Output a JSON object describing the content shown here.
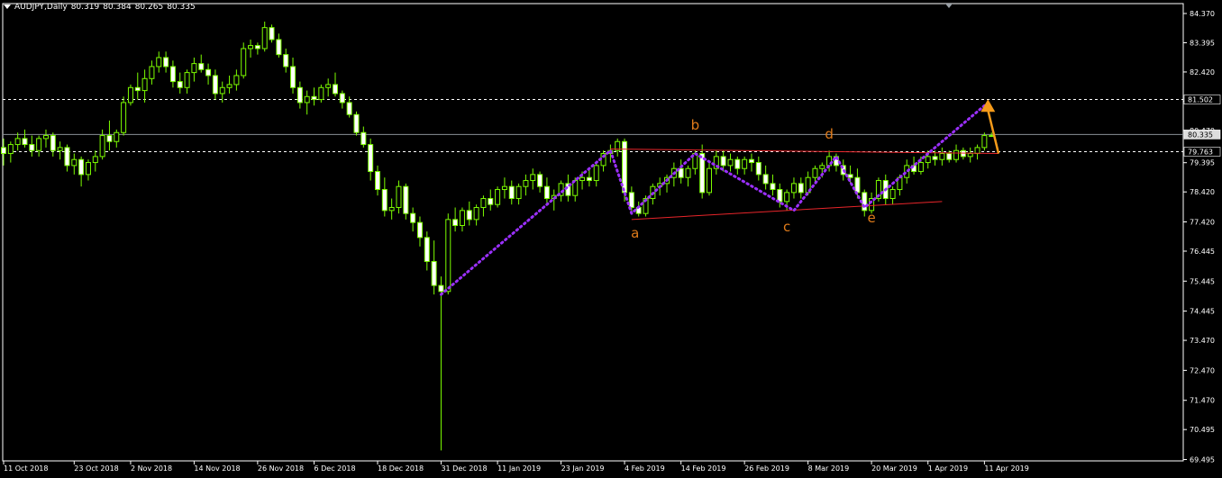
{
  "header": {
    "symbol": "AUDJPY,Daily",
    "open": "80.319",
    "high": "80.384",
    "low": "80.265",
    "close": "80.335"
  },
  "colors": {
    "background": "#000000",
    "frame": "#ffffff",
    "bull": "#000000",
    "candle_outline": "#7cfc00",
    "bear": "#ffffff",
    "wick": "#7cfc00",
    "dotted_line": "#9b30ff",
    "trend_line": "#e8252a",
    "wave_label": "#e07b1a",
    "arrow": "#f59b1a",
    "price_line": "#ffffff"
  },
  "chart_data": {
    "type": "candlestick",
    "symbol": "AUDJPY",
    "timeframe": "Daily",
    "yticks": [
      "84.370",
      "83.395",
      "82.420",
      "81.445",
      "80.470",
      "79.395",
      "78.420",
      "77.420",
      "76.445",
      "75.445",
      "74.445",
      "73.470",
      "72.470",
      "71.470",
      "70.495",
      "69.495"
    ],
    "ylim": [
      69.45,
      84.7
    ],
    "xlabels": [
      "11 Oct 2018",
      "23 Oct 2018",
      "2 Nov 2018",
      "14 Nov 2018",
      "26 Nov 2018",
      "6 Dec 2018",
      "18 Dec 2018",
      "31 Dec 2018",
      "11 Jan 2019",
      "23 Jan 2019",
      "4 Feb 2019",
      "14 Feb 2019",
      "26 Feb 2019",
      "8 Mar 2019",
      "20 Mar 2019",
      "1 Apr 2019",
      "11 Apr 2019"
    ],
    "x_label_bars": [
      0,
      10,
      18,
      27,
      36,
      44,
      53,
      62,
      70,
      79,
      88,
      96,
      105,
      114,
      123,
      131,
      139
    ],
    "bar_count": 143,
    "candles": [
      [
        79.9,
        80.2,
        79.3,
        79.7
      ],
      [
        79.7,
        80.1,
        79.4,
        80.0
      ],
      [
        80.0,
        80.4,
        79.8,
        80.2
      ],
      [
        80.2,
        80.5,
        79.9,
        80.0
      ],
      [
        80.0,
        80.3,
        79.6,
        79.8
      ],
      [
        79.8,
        80.3,
        79.6,
        80.2
      ],
      [
        80.2,
        80.5,
        79.9,
        80.3
      ],
      [
        80.3,
        80.4,
        79.6,
        79.8
      ],
      [
        79.8,
        80.1,
        79.5,
        79.9
      ],
      [
        79.9,
        80.0,
        79.1,
        79.3
      ],
      [
        79.3,
        79.7,
        79.0,
        79.5
      ],
      [
        79.5,
        79.6,
        78.6,
        79.0
      ],
      [
        79.0,
        79.5,
        78.8,
        79.4
      ],
      [
        79.4,
        79.8,
        79.1,
        79.6
      ],
      [
        79.6,
        80.5,
        79.5,
        80.3
      ],
      [
        80.3,
        80.8,
        79.8,
        80.1
      ],
      [
        80.1,
        80.5,
        79.9,
        80.4
      ],
      [
        80.4,
        81.6,
        80.3,
        81.4
      ],
      [
        81.4,
        82.0,
        81.3,
        81.9
      ],
      [
        81.9,
        82.4,
        81.5,
        81.8
      ],
      [
        81.8,
        82.5,
        81.4,
        82.2
      ],
      [
        82.2,
        82.8,
        82.0,
        82.6
      ],
      [
        82.6,
        83.1,
        82.4,
        82.9
      ],
      [
        82.9,
        83.1,
        82.4,
        82.6
      ],
      [
        82.6,
        82.8,
        81.9,
        82.1
      ],
      [
        82.1,
        82.4,
        81.7,
        81.9
      ],
      [
        81.9,
        82.5,
        81.7,
        82.4
      ],
      [
        82.4,
        82.9,
        82.1,
        82.7
      ],
      [
        82.7,
        83.0,
        82.4,
        82.5
      ],
      [
        82.5,
        82.7,
        82.0,
        82.3
      ],
      [
        82.3,
        82.5,
        81.5,
        81.7
      ],
      [
        81.7,
        82.1,
        81.4,
        81.9
      ],
      [
        81.9,
        82.3,
        81.7,
        82.0
      ],
      [
        82.0,
        82.5,
        81.8,
        82.3
      ],
      [
        82.3,
        83.4,
        82.2,
        83.2
      ],
      [
        83.2,
        83.5,
        82.9,
        83.3
      ],
      [
        83.3,
        83.4,
        83.0,
        83.2
      ],
      [
        83.2,
        84.1,
        83.1,
        83.9
      ],
      [
        83.9,
        84.0,
        83.4,
        83.5
      ],
      [
        83.5,
        83.7,
        82.9,
        83.0
      ],
      [
        83.0,
        83.2,
        82.4,
        82.6
      ],
      [
        82.6,
        82.9,
        81.7,
        81.9
      ],
      [
        81.9,
        82.1,
        81.2,
        81.4
      ],
      [
        81.4,
        81.8,
        81.0,
        81.6
      ],
      [
        81.6,
        81.9,
        81.3,
        81.5
      ],
      [
        81.5,
        82.0,
        81.4,
        81.9
      ],
      [
        81.9,
        82.2,
        81.6,
        82.0
      ],
      [
        82.0,
        82.4,
        81.6,
        81.7
      ],
      [
        81.7,
        81.8,
        81.2,
        81.4
      ],
      [
        81.4,
        81.6,
        80.9,
        81.0
      ],
      [
        81.0,
        81.1,
        80.3,
        80.4
      ],
      [
        80.4,
        80.6,
        79.9,
        80.0
      ],
      [
        80.0,
        80.2,
        78.8,
        79.1
      ],
      [
        79.1,
        79.3,
        78.3,
        78.5
      ],
      [
        78.5,
        78.9,
        77.6,
        77.8
      ],
      [
        77.8,
        78.2,
        77.5,
        77.9
      ],
      [
        77.9,
        78.8,
        77.7,
        78.6
      ],
      [
        78.6,
        78.7,
        77.5,
        77.7
      ],
      [
        77.7,
        77.9,
        77.1,
        77.4
      ],
      [
        77.4,
        77.6,
        76.6,
        76.9
      ],
      [
        76.9,
        77.1,
        75.8,
        76.1
      ],
      [
        76.1,
        76.8,
        75.0,
        75.3
      ],
      [
        75.3,
        75.6,
        69.8,
        75.1
      ],
      [
        75.1,
        77.7,
        75.0,
        77.5
      ],
      [
        77.5,
        77.9,
        77.1,
        77.3
      ],
      [
        77.3,
        77.9,
        77.1,
        77.8
      ],
      [
        77.8,
        78.1,
        77.3,
        77.5
      ],
      [
        77.5,
        78.0,
        77.3,
        77.9
      ],
      [
        77.9,
        78.3,
        77.6,
        78.2
      ],
      [
        78.2,
        78.5,
        77.8,
        78.0
      ],
      [
        78.0,
        78.6,
        77.9,
        78.5
      ],
      [
        78.5,
        78.9,
        78.2,
        78.6
      ],
      [
        78.6,
        78.8,
        78.0,
        78.2
      ],
      [
        78.2,
        78.7,
        78.0,
        78.6
      ],
      [
        78.6,
        79.0,
        78.3,
        78.8
      ],
      [
        78.8,
        79.2,
        78.5,
        79.0
      ],
      [
        79.0,
        79.1,
        78.4,
        78.6
      ],
      [
        78.6,
        78.9,
        78.0,
        78.2
      ],
      [
        78.2,
        78.5,
        77.8,
        78.3
      ],
      [
        78.3,
        78.8,
        78.1,
        78.7
      ],
      [
        78.7,
        79.0,
        78.1,
        78.3
      ],
      [
        78.3,
        78.9,
        78.1,
        78.8
      ],
      [
        78.8,
        79.1,
        78.5,
        78.9
      ],
      [
        78.9,
        79.2,
        78.6,
        78.8
      ],
      [
        78.8,
        79.4,
        78.6,
        79.3
      ],
      [
        79.3,
        79.8,
        79.1,
        79.7
      ],
      [
        79.7,
        80.0,
        79.4,
        79.8
      ],
      [
        79.8,
        80.2,
        79.6,
        80.1
      ],
      [
        80.1,
        80.2,
        78.1,
        78.4
      ],
      [
        78.4,
        78.6,
        77.7,
        77.9
      ],
      [
        77.9,
        78.1,
        77.6,
        77.7
      ],
      [
        77.7,
        78.3,
        77.6,
        78.2
      ],
      [
        78.2,
        78.7,
        78.0,
        78.6
      ],
      [
        78.6,
        78.9,
        78.3,
        78.7
      ],
      [
        78.7,
        79.0,
        78.4,
        78.9
      ],
      [
        78.9,
        79.4,
        78.6,
        79.2
      ],
      [
        79.2,
        79.5,
        78.7,
        78.9
      ],
      [
        78.9,
        79.3,
        78.6,
        79.2
      ],
      [
        79.2,
        79.8,
        79.0,
        79.7
      ],
      [
        79.7,
        80.0,
        78.2,
        78.4
      ],
      [
        78.4,
        79.4,
        78.3,
        79.2
      ],
      [
        79.2,
        79.8,
        79.0,
        79.6
      ],
      [
        79.6,
        79.8,
        79.1,
        79.3
      ],
      [
        79.3,
        79.7,
        79.1,
        79.5
      ],
      [
        79.5,
        79.6,
        79.0,
        79.2
      ],
      [
        79.2,
        79.6,
        79.0,
        79.5
      ],
      [
        79.5,
        79.7,
        79.1,
        79.4
      ],
      [
        79.4,
        79.6,
        78.8,
        79.0
      ],
      [
        79.0,
        79.3,
        78.5,
        78.7
      ],
      [
        78.7,
        79.0,
        78.3,
        78.5
      ],
      [
        78.5,
        78.7,
        77.9,
        78.1
      ],
      [
        78.1,
        78.5,
        77.8,
        78.4
      ],
      [
        78.4,
        78.9,
        78.2,
        78.7
      ],
      [
        78.7,
        78.9,
        78.2,
        78.4
      ],
      [
        78.4,
        79.1,
        78.3,
        78.9
      ],
      [
        78.9,
        79.3,
        78.7,
        79.2
      ],
      [
        79.2,
        79.4,
        78.9,
        79.3
      ],
      [
        79.3,
        79.8,
        79.1,
        79.6
      ],
      [
        79.6,
        79.7,
        79.1,
        79.3
      ],
      [
        79.3,
        79.5,
        78.8,
        79.0
      ],
      [
        79.0,
        79.3,
        78.7,
        78.9
      ],
      [
        78.9,
        79.2,
        78.2,
        78.4
      ],
      [
        78.4,
        78.5,
        77.6,
        77.8
      ],
      [
        77.8,
        78.4,
        77.7,
        78.2
      ],
      [
        78.2,
        78.9,
        78.1,
        78.8
      ],
      [
        78.8,
        79.0,
        78.0,
        78.2
      ],
      [
        78.2,
        78.6,
        78.0,
        78.5
      ],
      [
        78.5,
        79.0,
        78.3,
        78.9
      ],
      [
        78.9,
        79.5,
        78.7,
        79.3
      ],
      [
        79.3,
        79.6,
        79.0,
        79.1
      ],
      [
        79.1,
        79.6,
        79.0,
        79.4
      ],
      [
        79.4,
        79.8,
        79.2,
        79.6
      ],
      [
        79.6,
        79.8,
        79.3,
        79.5
      ],
      [
        79.5,
        79.9,
        79.3,
        79.7
      ],
      [
        79.7,
        79.8,
        79.4,
        79.5
      ],
      [
        79.5,
        80.0,
        79.4,
        79.8
      ],
      [
        79.8,
        79.9,
        79.5,
        79.6
      ],
      [
        79.6,
        79.9,
        79.4,
        79.7
      ],
      [
        79.7,
        80.0,
        79.5,
        79.9
      ],
      [
        79.9,
        80.4,
        79.8,
        80.3
      ],
      [
        80.3,
        80.4,
        80.3,
        80.3
      ]
    ],
    "hlines": [
      {
        "price": 81.502,
        "label": "81.502",
        "style": "dashed"
      },
      {
        "price": 80.335,
        "label": "80.335",
        "style": "solid"
      },
      {
        "price": 79.763,
        "label": "79.763",
        "style": "dashed"
      }
    ],
    "dotted_path": [
      {
        "bar": 62,
        "price": 75.0
      },
      {
        "bar": 86,
        "price": 79.8
      },
      {
        "bar": 89,
        "price": 77.7
      },
      {
        "bar": 98,
        "price": 79.7
      },
      {
        "bar": 112,
        "price": 77.8
      },
      {
        "bar": 118,
        "price": 79.6
      },
      {
        "bar": 122,
        "price": 77.9
      },
      {
        "bar": 139,
        "price": 81.3
      }
    ],
    "trend_lines": [
      {
        "from": {
          "bar": 86,
          "price": 79.85
        },
        "to": {
          "bar": 141,
          "price": 79.7
        }
      },
      {
        "from": {
          "bar": 89,
          "price": 77.5
        },
        "to": {
          "bar": 133,
          "price": 78.1
        }
      }
    ],
    "wave_labels": [
      {
        "text": "a",
        "bar": 89.5,
        "price": 76.9
      },
      {
        "text": "b",
        "bar": 98,
        "price": 80.5
      },
      {
        "text": "c",
        "bar": 111,
        "price": 77.1
      },
      {
        "text": "d",
        "bar": 117,
        "price": 80.2
      },
      {
        "text": "e",
        "bar": 123,
        "price": 77.4
      }
    ],
    "arrow": {
      "from": {
        "bar": 141,
        "price": 79.7
      },
      "to": {
        "bar": 139.5,
        "price": 81.45
      }
    }
  }
}
